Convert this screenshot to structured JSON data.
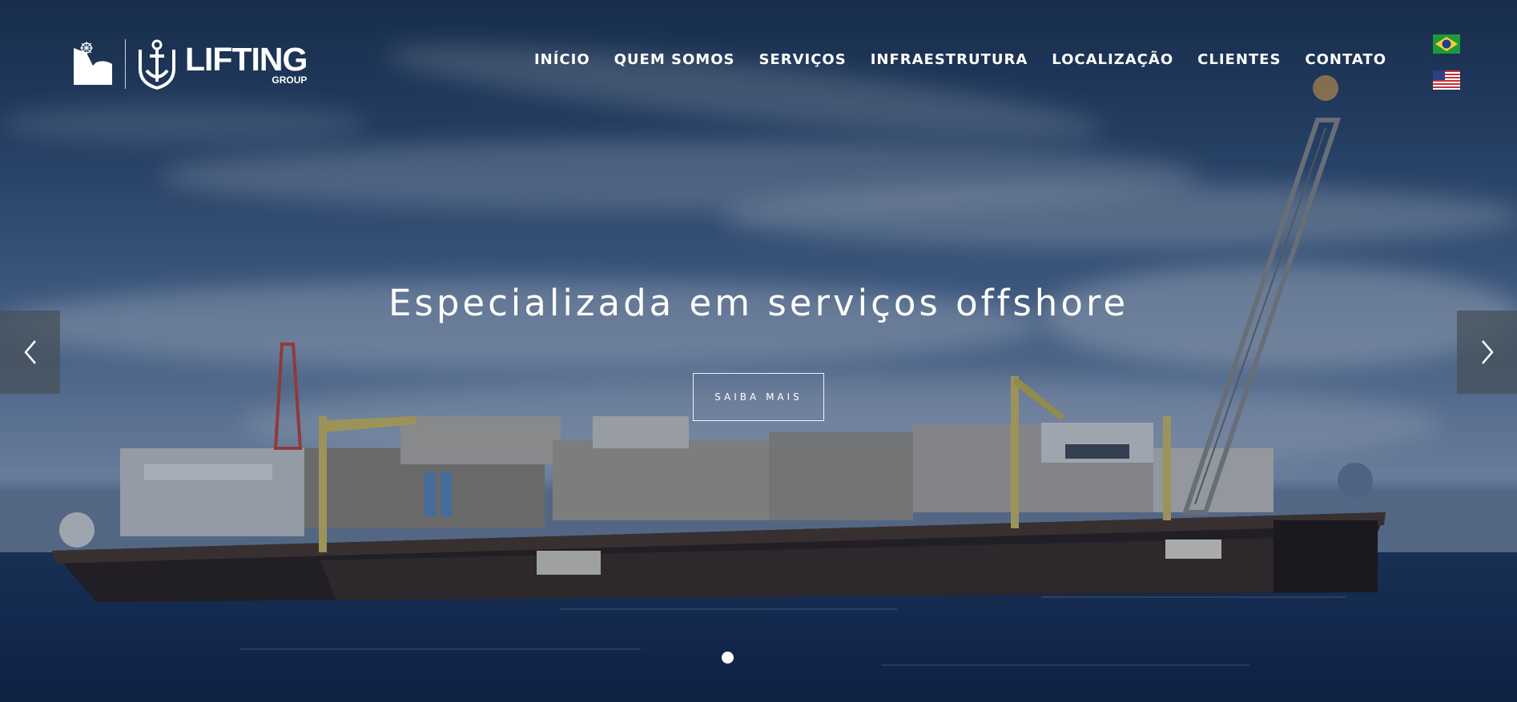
{
  "brand": {
    "name": "LIFTING",
    "sub": "GROUP"
  },
  "nav": {
    "items": [
      {
        "label": "INÍCIO"
      },
      {
        "label": "QUEM SOMOS"
      },
      {
        "label": "SERVIÇOS"
      },
      {
        "label": "INFRAESTRUTURA"
      },
      {
        "label": "LOCALIZAÇÃO"
      },
      {
        "label": "CLIENTES"
      },
      {
        "label": "CONTATO"
      }
    ]
  },
  "languages": [
    {
      "icon": "brazil-flag-icon"
    },
    {
      "icon": "us-flag-icon"
    }
  ],
  "hero": {
    "headline": "Especializada em serviços offshore",
    "cta_label": "SAIBA MAIS"
  },
  "slider": {
    "prev_icon": "chevron-left-icon",
    "next_icon": "chevron-right-icon",
    "slide_count": 1,
    "active_slide": 1
  },
  "colors": {
    "text": "#ffffff",
    "arrow_bg": "#46505a"
  }
}
